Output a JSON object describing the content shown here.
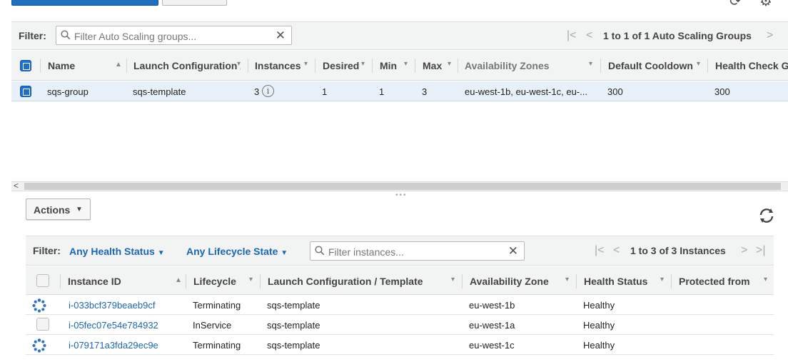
{
  "upper": {
    "filter_label": "Filter:",
    "search_placeholder": "Filter Auto Scaling groups...",
    "pagination": "1 to 1 of 1 Auto Scaling Groups",
    "columns": [
      "Name",
      "Launch Configuration /",
      "Instances",
      "Desired",
      "Min",
      "Max",
      "Availability Zones",
      "Default Cooldown",
      "Health Check Gr"
    ],
    "rows": [
      {
        "name": "sqs-group",
        "launch_config": "sqs-template",
        "instances": "3",
        "desired": "1",
        "min": "1",
        "max": "3",
        "availability_zones": "eu-west-1b, eu-west-1c, eu-...",
        "default_cooldown": "300",
        "health_check": "300"
      }
    ]
  },
  "lower": {
    "actions_label": "Actions",
    "filter_label": "Filter:",
    "health_filter": "Any Health Status",
    "lifecycle_filter": "Any Lifecycle State",
    "search_placeholder": "Filter instances...",
    "pagination": "1 to 3 of 3 Instances",
    "columns": [
      "Instance ID",
      "Lifecycle",
      "Launch Configuration / Template",
      "Availability Zone",
      "Health Status",
      "Protected from"
    ],
    "rows": [
      {
        "instance_id": "i-033bcf379beaeb9cf",
        "lifecycle": "Terminating",
        "template": "sqs-template",
        "zone": "eu-west-1b",
        "health": "Healthy",
        "icon": "spinner-icon"
      },
      {
        "instance_id": "i-05fec07e54e784932",
        "lifecycle": "InService",
        "template": "sqs-template",
        "zone": "eu-west-1a",
        "health": "Healthy",
        "icon": "checkbox"
      },
      {
        "instance_id": "i-079171a3fda29ec9e",
        "lifecycle": "Terminating",
        "template": "sqs-template",
        "zone": "eu-west-1c",
        "health": "Healthy",
        "icon": "spinner-icon"
      }
    ]
  },
  "colors": {
    "accent": "#1f6fcf",
    "link": "#1a67b5",
    "selected_row": "#e8f0fa",
    "header_bg": "#f2f3f3"
  }
}
